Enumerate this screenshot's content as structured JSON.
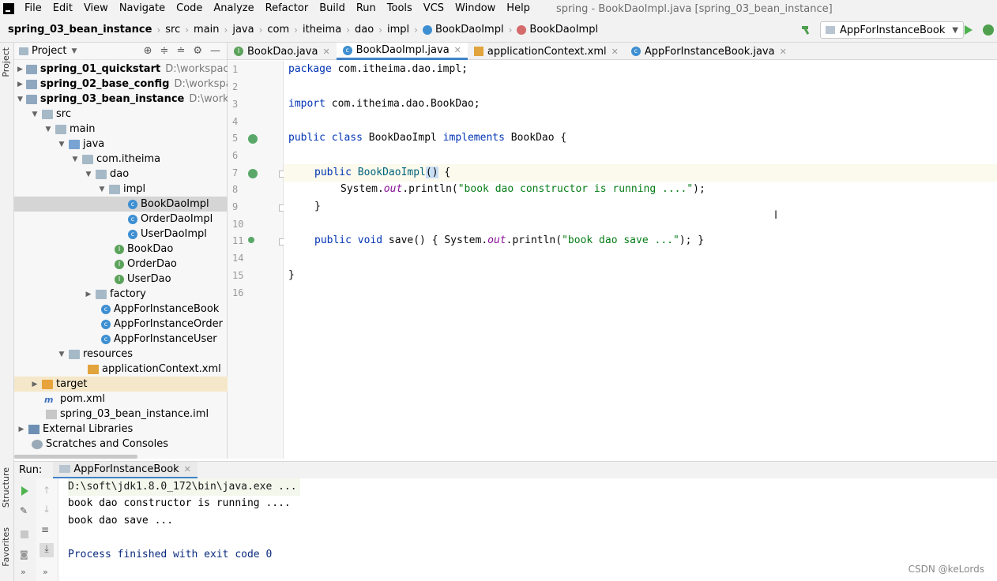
{
  "menubar": {
    "items": [
      "File",
      "Edit",
      "View",
      "Navigate",
      "Code",
      "Analyze",
      "Refactor",
      "Build",
      "Run",
      "Tools",
      "VCS",
      "Window",
      "Help"
    ],
    "window_title": "spring - BookDaoImpl.java [spring_03_bean_instance]"
  },
  "navbar": {
    "crumbs": [
      "spring_03_bean_instance",
      "src",
      "main",
      "java",
      "com",
      "itheima",
      "dao",
      "impl",
      "BookDaoImpl",
      "BookDaoImpl"
    ],
    "run_config": "AppForInstanceBook"
  },
  "left_strip": {
    "project_label": "Project",
    "structure_label": "Structure",
    "favorites_label": "Favorites"
  },
  "project_panel": {
    "title": "Project",
    "tree": [
      {
        "label": "spring_01_quickstart",
        "path": "D:\\workspace\\sp"
      },
      {
        "label": "spring_02_base_config",
        "path": "D:\\workspace\\s"
      },
      {
        "label": "spring_03_bean_instance",
        "path": "D:\\workspace"
      },
      {
        "label": "src"
      },
      {
        "label": "main"
      },
      {
        "label": "java"
      },
      {
        "label": "com.itheima"
      },
      {
        "label": "dao"
      },
      {
        "label": "impl"
      },
      {
        "label": "BookDaoImpl"
      },
      {
        "label": "OrderDaoImpl"
      },
      {
        "label": "UserDaoImpl"
      },
      {
        "label": "BookDao"
      },
      {
        "label": "OrderDao"
      },
      {
        "label": "UserDao"
      },
      {
        "label": "factory"
      },
      {
        "label": "AppForInstanceBook"
      },
      {
        "label": "AppForInstanceOrder"
      },
      {
        "label": "AppForInstanceUser"
      },
      {
        "label": "resources"
      },
      {
        "label": "applicationContext.xml"
      },
      {
        "label": "target"
      },
      {
        "label": "pom.xml"
      },
      {
        "label": "spring_03_bean_instance.iml"
      },
      {
        "label": "External Libraries"
      },
      {
        "label": "Scratches and Consoles"
      }
    ]
  },
  "tabs": [
    "BookDao.java",
    "BookDaoImpl.java",
    "applicationContext.xml",
    "AppForInstanceBook.java"
  ],
  "editor": {
    "line_numbers": [
      "1",
      "2",
      "3",
      "4",
      "5",
      "6",
      "7",
      "8",
      "9",
      "10",
      "11",
      "14",
      "15",
      "16"
    ],
    "lines": {
      "l1_kw": "package",
      "l1_rest": " com.itheima.dao.impl;",
      "l3_kw": "import",
      "l3_rest": " com.itheima.dao.BookDao;",
      "l5_kw1": "public class",
      "l5_mid": " BookDaoImpl ",
      "l5_kw2": "implements",
      "l5_rest": " BookDao {",
      "l7_kw": "public",
      "l7_name": " BookDaoImpl",
      "l7_paren": "()",
      "l7_rest": " {",
      "l8_a": "System.",
      "l8_fld": "out",
      "l8_b": ".println(",
      "l8_str": "\"book dao constructor is running ....\"",
      "l8_c": ");",
      "l9": "}",
      "l11_kw": "public void",
      "l11_a": " save() { System.",
      "l11_fld": "out",
      "l11_b": ".println(",
      "l11_str": "\"book dao save ...\"",
      "l11_c": "); }",
      "l15": "}"
    }
  },
  "run_panel": {
    "label": "Run:",
    "tab": "AppForInstanceBook",
    "console": [
      "D:\\soft\\jdk1.8.0_172\\bin\\java.exe ...",
      "book dao constructor is running ....",
      "book dao save ...",
      "Process finished with exit code 0"
    ]
  },
  "watermark": "CSDN @keLords"
}
